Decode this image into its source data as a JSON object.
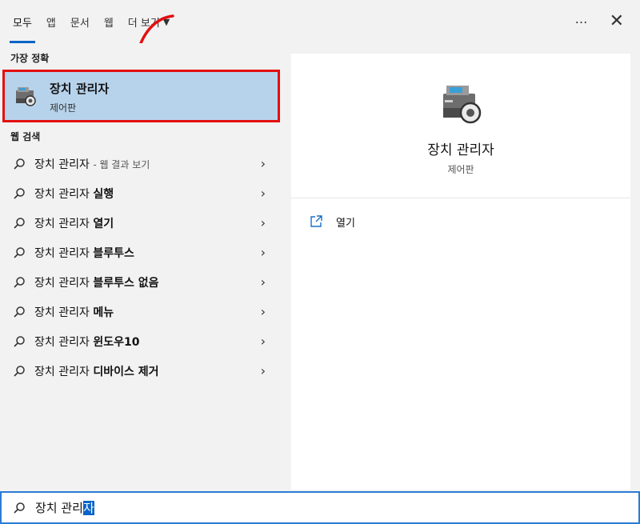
{
  "tabs": [
    {
      "label": "모두",
      "active": true
    },
    {
      "label": "앱"
    },
    {
      "label": "문서"
    },
    {
      "label": "웹"
    },
    {
      "label": "더 보기"
    }
  ],
  "top_icons": {
    "more": "⋯",
    "close": "✕"
  },
  "best_match": {
    "section": "가장 정확",
    "name": "장치 관리자",
    "sub": "제어판",
    "icon": "device-manager-icon"
  },
  "web": {
    "section": "웹 검색",
    "items": [
      {
        "prefix": "장치 관리자",
        "bold": "",
        "suffix": " - 웹 결과 보기"
      },
      {
        "prefix": "장치 관리자",
        "bold": "실행",
        "suffix": ""
      },
      {
        "prefix": "장치 관리자",
        "bold": "열기",
        "suffix": ""
      },
      {
        "prefix": "장치 관리자",
        "bold": "블루투스",
        "suffix": ""
      },
      {
        "prefix": "장치 관리자",
        "bold": "블루투스 없음",
        "suffix": ""
      },
      {
        "prefix": "장치 관리자",
        "bold": "메뉴",
        "suffix": ""
      },
      {
        "prefix": "장치 관리자",
        "bold": "윈도우10",
        "suffix": ""
      },
      {
        "prefix": "장치 관리자",
        "bold": "디바이스 제거",
        "suffix": ""
      }
    ]
  },
  "preview": {
    "title": "장치 관리자",
    "sub": "제어판",
    "action_label": "열기"
  },
  "search": {
    "query_plain": "장치 관리",
    "query_selected": "자"
  },
  "colors": {
    "accent": "#0a64c8",
    "highlight": "#b7d3eb",
    "annotation_red": "#e30f0f"
  }
}
